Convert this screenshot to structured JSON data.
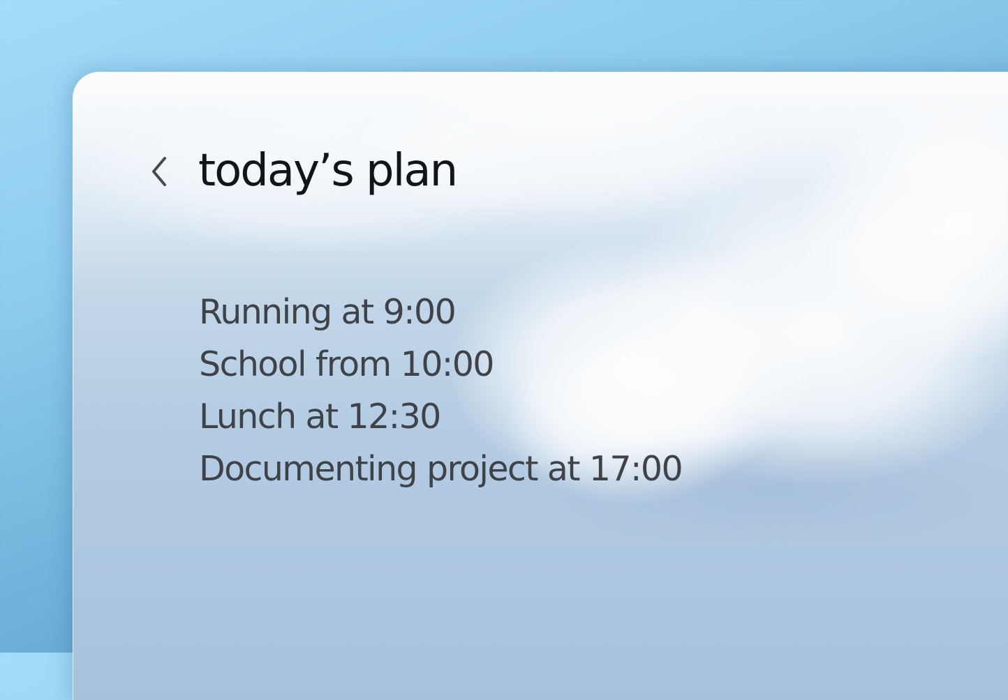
{
  "header": {
    "back_icon": "chevron-left-icon",
    "title": "today’s plan"
  },
  "plan": {
    "items": [
      "Running at 9:00",
      "School from 10:00",
      "Lunch at 12:30",
      "Documenting project at 17:00"
    ]
  },
  "colors": {
    "background": "#8ecbee",
    "title_text": "#111418",
    "item_text": "#3f4348"
  }
}
